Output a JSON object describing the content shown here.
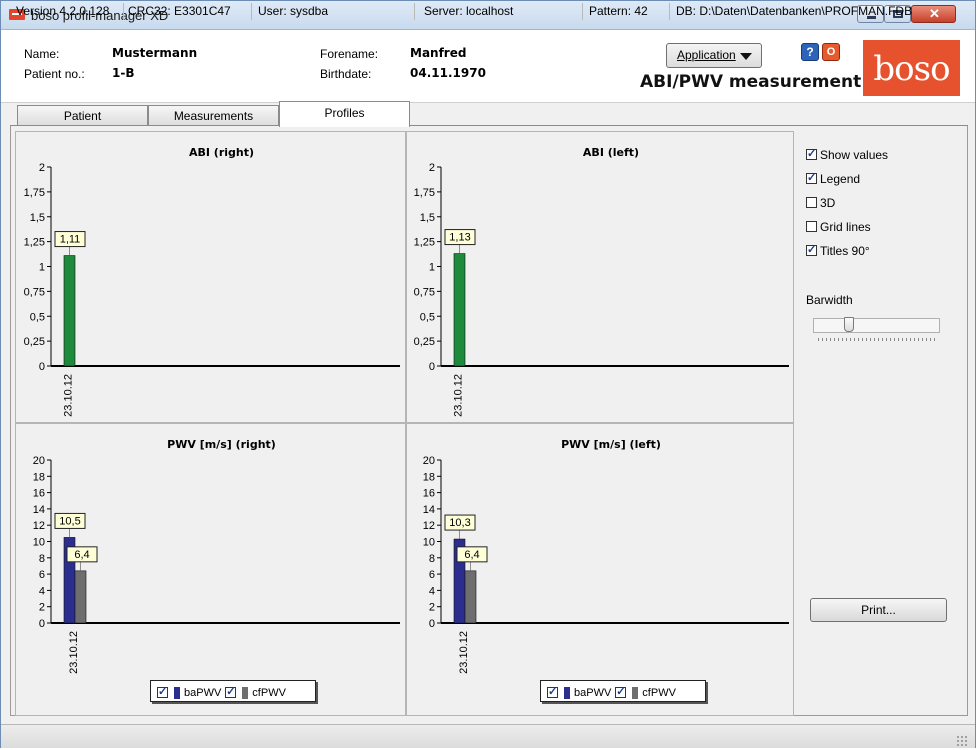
{
  "window": {
    "title": "boso profil-manager XD"
  },
  "patient": {
    "name_label": "Name:",
    "name": "Mustermann",
    "patient_no_label": "Patient no.:",
    "patient_no": "1-B",
    "forename_label": "Forename:",
    "forename": "Manfred",
    "birthdate_label": "Birthdate:",
    "birthdate": "04.11.1970"
  },
  "header": {
    "application_button": "Application",
    "measurement_title": "ABI/PWV measurement",
    "logo_text": "boso",
    "help_icon": "?",
    "power_icon": "O"
  },
  "tabs": [
    {
      "label": "Patient"
    },
    {
      "label": "Measurements"
    },
    {
      "label": "Profiles",
      "active": true
    }
  ],
  "options": {
    "show_values": {
      "label": "Show values",
      "checked": true
    },
    "legend": {
      "label": "Legend",
      "checked": true
    },
    "three_d": {
      "label": "3D",
      "checked": false
    },
    "grid_lines": {
      "label": "Grid lines",
      "checked": false
    },
    "titles_90": {
      "label": "Titles 90°",
      "checked": true
    },
    "barwidth_label": "Barwidth",
    "barwidth_level": 0.25,
    "print_button": "Print..."
  },
  "status": {
    "version": "Version 4.2.0.128",
    "crc": "CRC32: E3301C47",
    "user": "User: sysdba",
    "server": "Server: localhost",
    "pattern": "Pattern: 42",
    "db": "DB: D:\\Daten\\Datenbanken\\PROFMAN.FDB"
  },
  "chart_data": [
    {
      "type": "bar",
      "title": "ABI (right)",
      "categories": [
        "23.10.12"
      ],
      "ylim": [
        0,
        2
      ],
      "yticks": [
        "0",
        "0,25",
        "0,5",
        "0,75",
        "1",
        "1,25",
        "1,5",
        "1,75",
        "2"
      ],
      "series": [
        {
          "values": [
            1.11
          ],
          "labels": [
            "1,11"
          ],
          "color": "#1e8a3c"
        }
      ]
    },
    {
      "type": "bar",
      "title": "ABI (left)",
      "categories": [
        "23.10.12"
      ],
      "ylim": [
        0,
        2
      ],
      "yticks": [
        "0",
        "0,25",
        "0,5",
        "0,75",
        "1",
        "1,25",
        "1,5",
        "1,75",
        "2"
      ],
      "series": [
        {
          "values": [
            1.13
          ],
          "labels": [
            "1,13"
          ],
          "color": "#1e8a3c"
        }
      ]
    },
    {
      "type": "bar",
      "title": "PWV [m/s] (right)",
      "categories": [
        "23.10.12"
      ],
      "ylim": [
        0,
        20
      ],
      "yticks": [
        "0",
        "2",
        "4",
        "6",
        "8",
        "10",
        "12",
        "14",
        "16",
        "18",
        "20"
      ],
      "series": [
        {
          "name": "baPWV",
          "values": [
            10.5
          ],
          "labels": [
            "10,5"
          ],
          "color": "#2b2e8f"
        },
        {
          "name": "cfPWV",
          "values": [
            6.4
          ],
          "labels": [
            "6,4"
          ],
          "color": "#6e6e6e"
        }
      ],
      "legend": "bottom"
    },
    {
      "type": "bar",
      "title": "PWV [m/s] (left)",
      "categories": [
        "23.10.12"
      ],
      "ylim": [
        0,
        20
      ],
      "yticks": [
        "0",
        "2",
        "4",
        "6",
        "8",
        "10",
        "12",
        "14",
        "16",
        "18",
        "20"
      ],
      "series": [
        {
          "name": "baPWV",
          "values": [
            10.3
          ],
          "labels": [
            "10,3"
          ],
          "color": "#2b2e8f"
        },
        {
          "name": "cfPWV",
          "values": [
            6.4
          ],
          "labels": [
            "6,4"
          ],
          "color": "#6e6e6e"
        }
      ],
      "legend": "bottom"
    }
  ]
}
